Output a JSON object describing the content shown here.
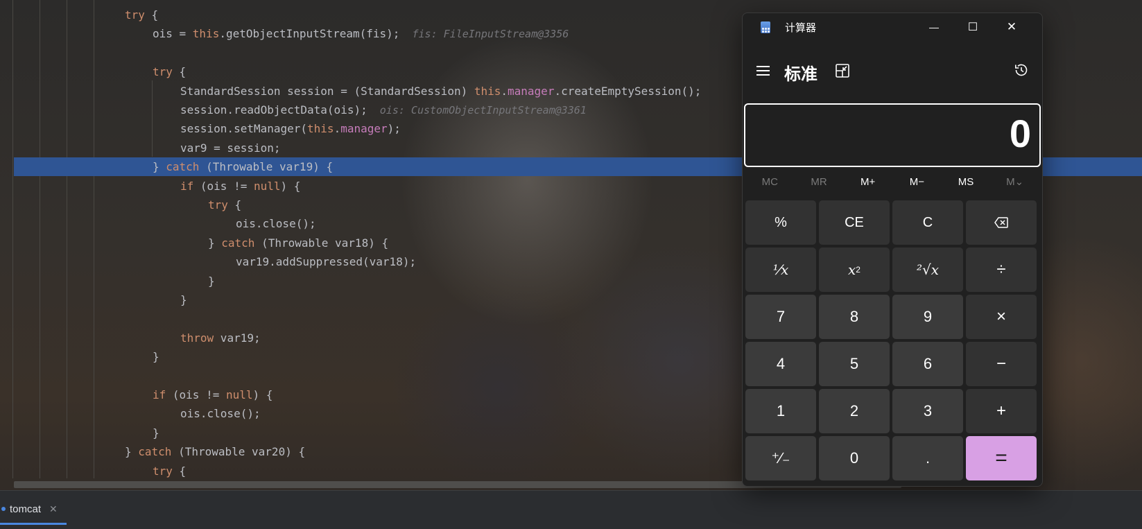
{
  "ide": {
    "code_lines": [
      {
        "segments": [
          {
            "t": "try",
            "c": "kw"
          },
          {
            "t": " {"
          }
        ]
      },
      {
        "segments": [
          {
            "t": "ois = "
          },
          {
            "t": "this",
            "c": "kw"
          },
          {
            "t": ".getObjectInputStream(fis);"
          },
          {
            "t": "  fis: FileInputStream@3356",
            "c": "hint"
          }
        ]
      },
      {
        "segments": []
      },
      {
        "segments": [
          {
            "t": "try",
            "c": "kw"
          },
          {
            "t": " {"
          }
        ]
      },
      {
        "segments": [
          {
            "t": "StandardSession session = (StandardSession) "
          },
          {
            "t": "this",
            "c": "kw"
          },
          {
            "t": "."
          },
          {
            "t": "manager",
            "c": "fld"
          },
          {
            "t": ".createEmptySession();"
          }
        ]
      },
      {
        "segments": [
          {
            "t": "session.readObjectData(ois);"
          },
          {
            "t": "  ois: CustomObjectInputStream@3361",
            "c": "hint"
          }
        ]
      },
      {
        "segments": [
          {
            "t": "session.setManager("
          },
          {
            "t": "this",
            "c": "kw"
          },
          {
            "t": "."
          },
          {
            "t": "manager",
            "c": "fld"
          },
          {
            "t": ");"
          }
        ]
      },
      {
        "segments": [
          {
            "t": "var9 = session;"
          }
        ]
      },
      {
        "segments": [
          {
            "t": "} "
          },
          {
            "t": "catch",
            "c": "kw"
          },
          {
            "t": " (Throwable var19) {"
          }
        ]
      },
      {
        "segments": [
          {
            "t": "if",
            "c": "kw"
          },
          {
            "t": " (ois != "
          },
          {
            "t": "null",
            "c": "kw"
          },
          {
            "t": ") {"
          }
        ]
      },
      {
        "segments": [
          {
            "t": "try",
            "c": "kw"
          },
          {
            "t": " {"
          }
        ]
      },
      {
        "segments": [
          {
            "t": "ois.close();"
          }
        ]
      },
      {
        "segments": [
          {
            "t": "} "
          },
          {
            "t": "catch",
            "c": "kw"
          },
          {
            "t": " (Throwable var18) {"
          }
        ]
      },
      {
        "segments": [
          {
            "t": "var19.addSuppressed(var18);"
          }
        ]
      },
      {
        "segments": [
          {
            "t": "}"
          }
        ]
      },
      {
        "segments": [
          {
            "t": "}"
          }
        ]
      },
      {
        "segments": []
      },
      {
        "segments": [
          {
            "t": "throw",
            "c": "kw"
          },
          {
            "t": " var19;"
          }
        ]
      },
      {
        "segments": [
          {
            "t": "}"
          }
        ]
      },
      {
        "segments": []
      },
      {
        "segments": [
          {
            "t": "if",
            "c": "kw"
          },
          {
            "t": " (ois != "
          },
          {
            "t": "null",
            "c": "kw"
          },
          {
            "t": ") {"
          }
        ]
      },
      {
        "segments": [
          {
            "t": "ois.close();"
          }
        ]
      },
      {
        "segments": [
          {
            "t": "}"
          }
        ]
      },
      {
        "segments": [
          {
            "t": "} "
          },
          {
            "t": "catch",
            "c": "kw"
          },
          {
            "t": " (Throwable var20) {"
          }
        ]
      },
      {
        "segments": [
          {
            "t": "try",
            "c": "kw"
          },
          {
            "t": " {"
          }
        ]
      }
    ],
    "bottom_tab": {
      "label": "tomcat",
      "close": "✕"
    }
  },
  "calculator": {
    "title": "计算器",
    "mode": "标准",
    "display": "0",
    "window_controls": {
      "minimize": "—",
      "maximize": "☐",
      "close": "✕"
    },
    "memory": [
      {
        "label": "MC",
        "enabled": false
      },
      {
        "label": "MR",
        "enabled": false
      },
      {
        "label": "M+",
        "enabled": true
      },
      {
        "label": "M−",
        "enabled": true
      },
      {
        "label": "MS",
        "enabled": true
      },
      {
        "label": "M⌄",
        "enabled": false
      }
    ],
    "keys": {
      "percent": "%",
      "ce": "CE",
      "c": "C",
      "backspace": "⌫",
      "reciprocal": "⅟x",
      "square_base": "x",
      "square_exp": "2",
      "sqrt": "²√x",
      "divide": "÷",
      "seven": "7",
      "eight": "8",
      "nine": "9",
      "multiply": "×",
      "four": "4",
      "five": "5",
      "six": "6",
      "minus": "−",
      "one": "1",
      "two": "2",
      "three": "3",
      "plus": "+",
      "negate": "⁺∕₋",
      "zero": "0",
      "decimal": ".",
      "equals": "="
    },
    "colors": {
      "accent": "#d8a0e4",
      "window_bg": "#202020",
      "key_bg": "#3b3b3b"
    }
  }
}
